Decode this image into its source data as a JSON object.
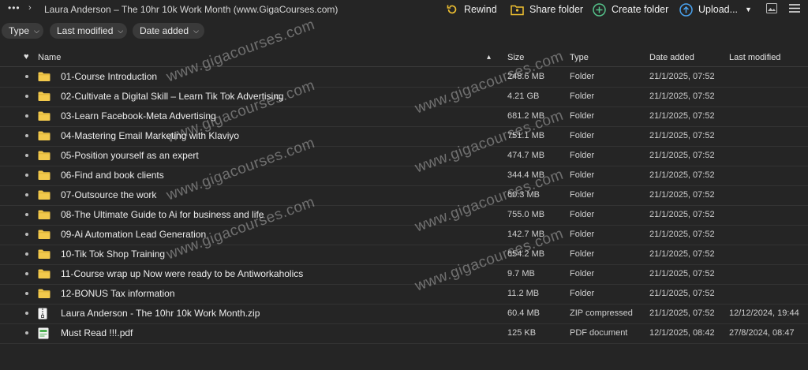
{
  "topbar": {
    "more_label": "•••",
    "title": "Laura Anderson – The 10hr 10k Work Month (www.GigaCourses.com)",
    "buttons": {
      "rewind": "Rewind",
      "share_folder": "Share folder",
      "create_folder": "Create folder",
      "upload": "Upload..."
    }
  },
  "filters": [
    "Type",
    "Last modified",
    "Date added"
  ],
  "columns": {
    "name": "Name",
    "size": "Size",
    "type": "Type",
    "date_added": "Date added",
    "last_modified": "Last modified"
  },
  "rows": [
    {
      "name": "01-Course Introduction",
      "size": "248.6 MB",
      "type": "Folder",
      "date_added": "21/1/2025, 07:52",
      "last_modified": "",
      "icon": "folder-icon"
    },
    {
      "name": "02-Cultivate a Digital Skill – Learn Tik Tok Advertising",
      "size": "4.21 GB",
      "type": "Folder",
      "date_added": "21/1/2025, 07:52",
      "last_modified": "",
      "icon": "folder-icon"
    },
    {
      "name": "03-Learn Facebook-Meta Advertising",
      "size": "681.2 MB",
      "type": "Folder",
      "date_added": "21/1/2025, 07:52",
      "last_modified": "",
      "icon": "folder-icon"
    },
    {
      "name": "04-Mastering Email Marketing with Klaviyo",
      "size": "751.1 MB",
      "type": "Folder",
      "date_added": "21/1/2025, 07:52",
      "last_modified": "",
      "icon": "folder-icon"
    },
    {
      "name": "05-Position yourself as an expert",
      "size": "474.7 MB",
      "type": "Folder",
      "date_added": "21/1/2025, 07:52",
      "last_modified": "",
      "icon": "folder-icon"
    },
    {
      "name": "06-Find and book clients",
      "size": "344.4 MB",
      "type": "Folder",
      "date_added": "21/1/2025, 07:52",
      "last_modified": "",
      "icon": "folder-icon"
    },
    {
      "name": "07-Outsource the work",
      "size": "60.3 MB",
      "type": "Folder",
      "date_added": "21/1/2025, 07:52",
      "last_modified": "",
      "icon": "folder-icon"
    },
    {
      "name": "08-The Ultimate Guide to Ai for business and life",
      "size": "755.0 MB",
      "type": "Folder",
      "date_added": "21/1/2025, 07:52",
      "last_modified": "",
      "icon": "folder-icon"
    },
    {
      "name": "09-Ai Automation Lead Generation",
      "size": "142.7 MB",
      "type": "Folder",
      "date_added": "21/1/2025, 07:52",
      "last_modified": "",
      "icon": "folder-icon"
    },
    {
      "name": "10-Tik Tok Shop Training",
      "size": "654.2 MB",
      "type": "Folder",
      "date_added": "21/1/2025, 07:52",
      "last_modified": "",
      "icon": "folder-icon"
    },
    {
      "name": "11-Course wrap up Now were ready to be Antiworkaholics",
      "size": "9.7 MB",
      "type": "Folder",
      "date_added": "21/1/2025, 07:52",
      "last_modified": "",
      "icon": "folder-icon"
    },
    {
      "name": "12-BONUS Tax information",
      "size": "11.2 MB",
      "type": "Folder",
      "date_added": "21/1/2025, 07:52",
      "last_modified": "",
      "icon": "folder-icon"
    },
    {
      "name": "Laura Anderson - The 10hr 10k Work Month.zip",
      "size": "60.4 MB",
      "type": "ZIP compressed",
      "date_added": "21/1/2025, 07:52",
      "last_modified": "12/12/2024, 19:44",
      "icon": "zip-file-icon"
    },
    {
      "name": "Must Read !!!.pdf",
      "size": "125 KB",
      "type": "PDF document",
      "date_added": "12/1/2025, 08:42",
      "last_modified": "27/8/2024, 08:47",
      "icon": "pdf-file-icon"
    }
  ],
  "watermarks": [
    "www.gigacourses.com",
    "www.gigacourses.com",
    "www.gigacourses.com",
    "www.gigacourses.com",
    "www.gigacourses.com",
    "www.gigacourses.com",
    "www.gigacourses.com",
    "www.gigacourses.com"
  ],
  "colors": {
    "background": "#252525",
    "folder": "#f2c94c",
    "accent_yellow": "#f2c230",
    "accent_green": "#55c28a",
    "accent_blue": "#4aa3f0"
  }
}
